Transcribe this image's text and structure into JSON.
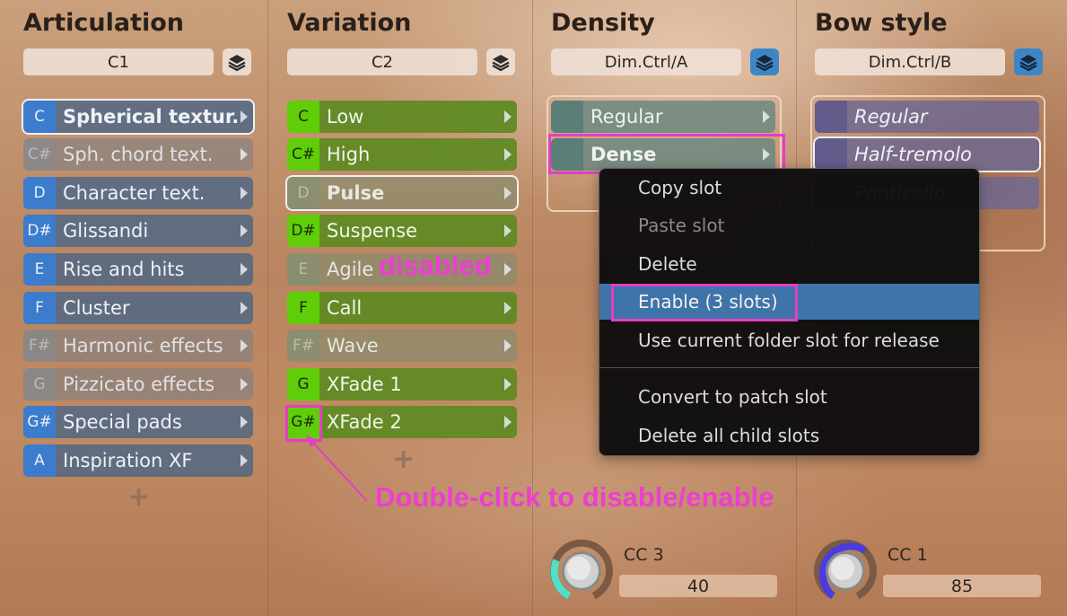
{
  "columns": [
    {
      "title": "Articulation",
      "field": "C1"
    },
    {
      "title": "Variation",
      "field": "C2"
    },
    {
      "title": "Density",
      "field": "Dim.Ctrl/A"
    },
    {
      "title": "Bow style",
      "field": "Dim.Ctrl/B"
    }
  ],
  "articulation_slots": [
    {
      "key": "C",
      "label": "Spherical textur."
    },
    {
      "key": "C#",
      "label": "Sph. chord text."
    },
    {
      "key": "D",
      "label": "Character text."
    },
    {
      "key": "D#",
      "label": "Glissandi"
    },
    {
      "key": "E",
      "label": "Rise and hits"
    },
    {
      "key": "F",
      "label": "Cluster"
    },
    {
      "key": "F#",
      "label": "Harmonic effects"
    },
    {
      "key": "G",
      "label": "Pizzicato effects"
    },
    {
      "key": "G#",
      "label": "Special pads"
    },
    {
      "key": "A",
      "label": "Inspiration XF"
    }
  ],
  "variation_slots": [
    {
      "key": "C",
      "label": "Low"
    },
    {
      "key": "C#",
      "label": "High"
    },
    {
      "key": "D",
      "label": "Pulse"
    },
    {
      "key": "D#",
      "label": "Suspense"
    },
    {
      "key": "E",
      "label": "Agile"
    },
    {
      "key": "F",
      "label": "Call"
    },
    {
      "key": "F#",
      "label": "Wave"
    },
    {
      "key": "G",
      "label": "XFade 1"
    },
    {
      "key": "G#",
      "label": "XFade 2"
    }
  ],
  "density_slots": [
    {
      "label": "Regular"
    },
    {
      "label": "Dense"
    }
  ],
  "bow_slots": [
    {
      "label": "Regular"
    },
    {
      "label": "Half-tremolo"
    },
    {
      "label": "Ponticello"
    }
  ],
  "plus_symbol": "+",
  "context_menu": {
    "items": [
      "Copy slot",
      "Paste slot",
      "Delete",
      "Enable (3 slots)",
      "Use current folder slot for release",
      "Convert to patch slot",
      "Delete all child slots"
    ]
  },
  "annotations": {
    "disabled": "disabled",
    "double_click": "Double-click to disable/enable"
  },
  "controls": [
    {
      "label": "CC 3",
      "value": "40",
      "ring_color": "#4fe0c8"
    },
    {
      "label": "CC 1",
      "value": "85",
      "ring_color": "#4a3ce0"
    }
  ],
  "colors": {
    "highlight": "#e53ec5",
    "articulation_key": "#3b7ccd",
    "variation_key": "#5fce08",
    "menu_active": "#3f74a8"
  }
}
